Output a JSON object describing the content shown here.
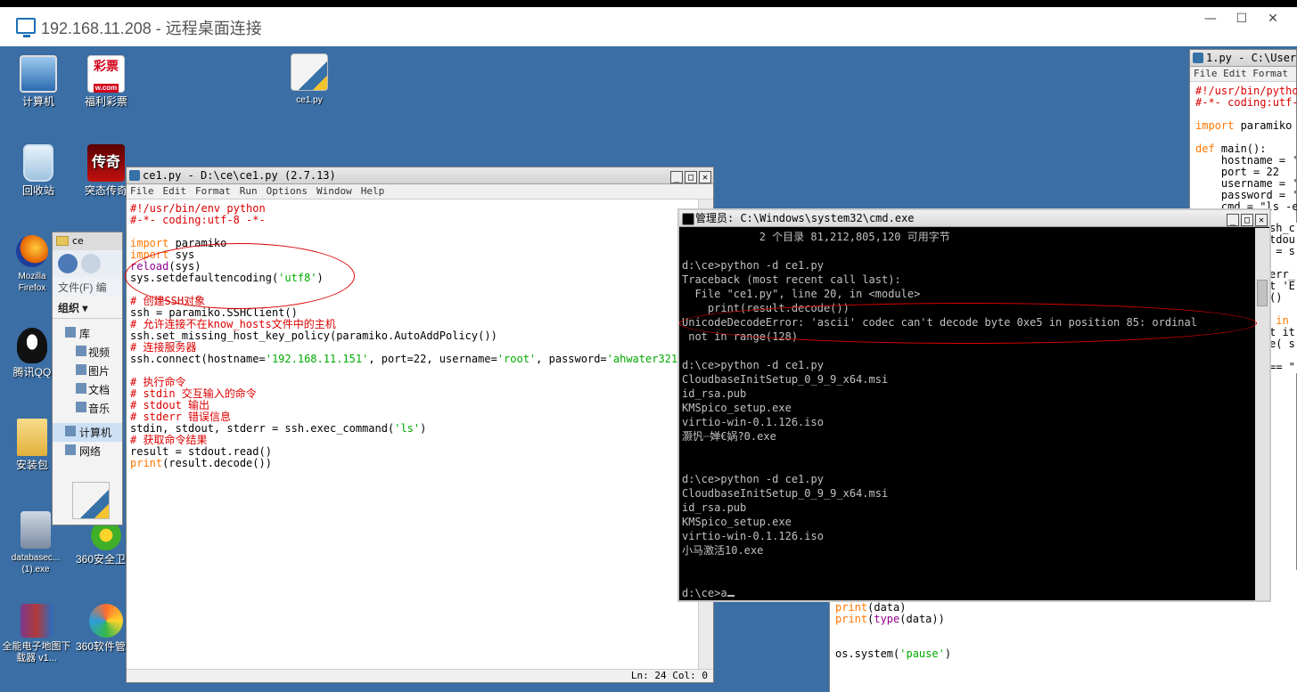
{
  "rdp": {
    "title": "192.168.11.208 - 远程桌面连接"
  },
  "desktop_icons": [
    {
      "label": "计算机"
    },
    {
      "label": "福利彩票"
    },
    {
      "label": "ce1.py"
    },
    {
      "label": "回收站"
    },
    {
      "label": "突态传奇"
    },
    {
      "label": "Mozilla Firefox"
    },
    {
      "label": "腾讯QQ"
    },
    {
      "label": "安装包"
    },
    {
      "label": "databasec...(1).exe"
    },
    {
      "label": "360安全卫士"
    },
    {
      "label": "全能电子地图下载器 v1..."
    },
    {
      "label": "360软件管家"
    }
  ],
  "icon_glyphs": {
    "caipiao": "彩票",
    "caipiao_sub": "w.com",
    "game": "传奇"
  },
  "editor": {
    "title": "ce1.py - D:\\ce\\ce1.py (2.7.13)",
    "menu": [
      "File",
      "Edit",
      "Format",
      "Run",
      "Options",
      "Window",
      "Help"
    ],
    "status": "Ln: 24  Col: 0",
    "code": [
      "#!/usr/bin/env python",
      "#-*- coding:utf-8 -*-",
      "",
      "import paramiko",
      "import sys",
      "reload(sys)",
      "sys.setdefaultencoding('utf8')",
      "",
      "# 创建SSH对象",
      "ssh = paramiko.SSHClient()",
      "# 允许连接不在know_hosts文件中的主机",
      "ssh.set_missing_host_key_policy(paramiko.AutoAddPolicy())",
      "# 连接服务器",
      "ssh.connect(hostname='192.168.11.151', port=22, username='root', password='ahwater321')",
      "",
      "# 执行命令",
      "# stdin 交互输入的命令",
      "# stdout 输出",
      "# stderr 错误信息",
      "stdin, stdout, stderr = ssh.exec_command('ls')",
      "# 获取命令结果",
      "result = stdout.read()",
      "print(result.decode())"
    ]
  },
  "explorer": {
    "title": "ce",
    "menu": "文件(F)  编",
    "organize": "组织 ▾",
    "nav": [
      "库",
      "视频",
      "图片",
      "文档",
      "音乐",
      "计算机",
      "网络"
    ]
  },
  "editor2": {
    "title": "1.py - C:\\User",
    "menu": "File  Edit  Format",
    "code_top": [
      "#!/usr/bin/pytho",
      "#-*- coding:utf-",
      "",
      "import paramiko",
      "",
      "def main():",
      "    hostname = '",
      "    port = 22",
      "    username = '",
      "    password = '",
      "    cmd = \"ls -e"
    ],
    "code_mid": [
      "sh_c",
      "tdou",
      " = s",
      "",
      "err_",
      "t 'E",
      "()",
      "",
      " in",
      "t it",
      "e( s",
      "",
      "== \""
    ],
    "code_bottom": [
      "print(data)",
      "print(type(data))",
      "",
      "",
      "os.system('pause')"
    ],
    "side_fragment": "ostn"
  },
  "cmd": {
    "title": "管理员: C:\\Windows\\system32\\cmd.exe",
    "lines": [
      "            2 个目录 81,212,805,120 可用字节",
      "",
      "d:\\ce>python -d ce1.py",
      "Traceback (most recent call last):",
      "  File \"ce1.py\", line 20, in <module>",
      "    print(result.decode())",
      "UnicodeDecodeError: 'ascii' codec can't decode byte 0xe5 in position 85: ordinal",
      " not in range(128)",
      "",
      "d:\\ce>python -d ce1.py",
      "CloudbaseInitSetup_0_9_9_x64.msi",
      "id_rsa.pub",
      "KMSpico_setup.exe",
      "virtio-win-0.1.126.iso",
      "灏忛┈婵€娲?0.exe",
      "",
      "",
      "d:\\ce>python -d ce1.py",
      "CloudbaseInitSetup_0_9_9_x64.msi",
      "id_rsa.pub",
      "KMSpico_setup.exe",
      "virtio-win-0.1.126.iso",
      "小马激活10.exe",
      "",
      "",
      "d:\\ce>a"
    ]
  },
  "colors": {
    "desktop": "#3a6ea5",
    "annotation": "#dd0000",
    "comment": "#dd0000",
    "keyword": "#ff7700",
    "string": "#00aa00"
  }
}
